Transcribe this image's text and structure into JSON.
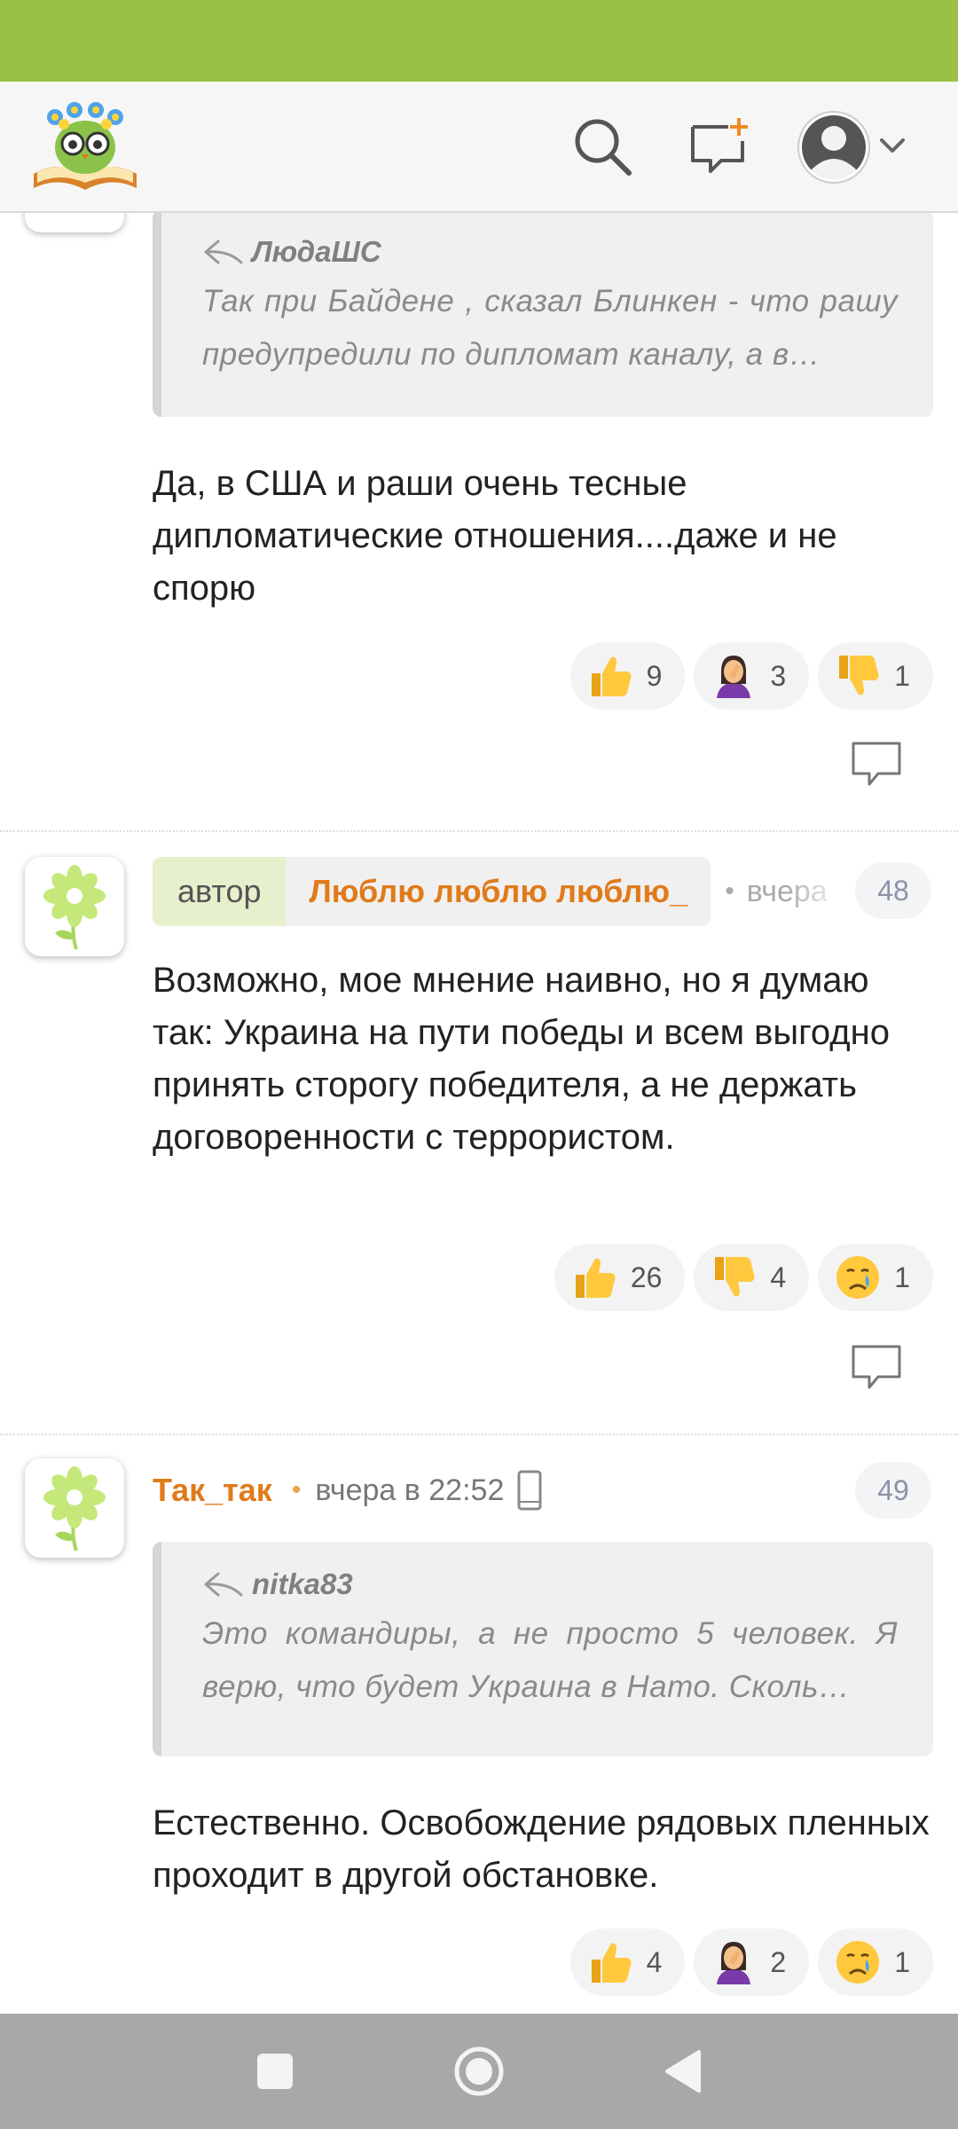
{
  "colors": {
    "status_bar": "#9ac045",
    "accent_orange": "#e07b1a",
    "author_tag_bg": "#e7f0cc",
    "nav_bar": "#a8a8a8"
  },
  "header": {
    "logo_icon": "owl-book-logo",
    "search_icon": "search-icon",
    "new_post_icon": "new-message-icon",
    "profile_icon": "user-avatar-icon",
    "menu_icon": "chevron-down-icon"
  },
  "comments": [
    {
      "quote": {
        "author": "ЛюдаШС",
        "text": "Так при Байдене , сказал Блинкен - что рашу предупредили по дипломат каналу, а в…"
      },
      "text": "Да, в США и раши очень тесные дипломатические отношения....даже и не спорю",
      "reactions": [
        {
          "icon": "thumbs-up-icon",
          "count": "9"
        },
        {
          "icon": "facepalm-icon",
          "count": "3"
        },
        {
          "icon": "thumbs-down-icon",
          "count": "1"
        }
      ]
    },
    {
      "author_tag": "автор",
      "author_title": "Люблю люблю люблю_",
      "time": "вчера",
      "number": "48",
      "text": "Возможно, мое мнение наивно, но я думаю так: Украина на пути победы и всем выгодно принять сторогу победителя, а не держать договоренности с террористом.",
      "reactions": [
        {
          "icon": "thumbs-up-icon",
          "count": "26"
        },
        {
          "icon": "thumbs-down-icon",
          "count": "4"
        },
        {
          "icon": "crying-face-icon",
          "count": "1"
        }
      ]
    },
    {
      "username": "Так_так",
      "time": "вчера в 22:52",
      "device_icon": "mobile-phone-icon",
      "number": "49",
      "quote": {
        "author": "nitka83",
        "text": "Это командиры, а не просто 5 человек. Я верю, что будет Украина в Нато. Сколь…"
      },
      "text": "Естественно. Освобождение рядовых пленных проходит в другой обстановке.",
      "reactions": [
        {
          "icon": "thumbs-up-icon",
          "count": "4"
        },
        {
          "icon": "facepalm-icon",
          "count": "2"
        },
        {
          "icon": "crying-face-icon",
          "count": "1"
        }
      ]
    }
  ],
  "navbar": {
    "recent_icon": "square-icon",
    "home_icon": "circle-icon",
    "back_icon": "triangle-back-icon"
  }
}
